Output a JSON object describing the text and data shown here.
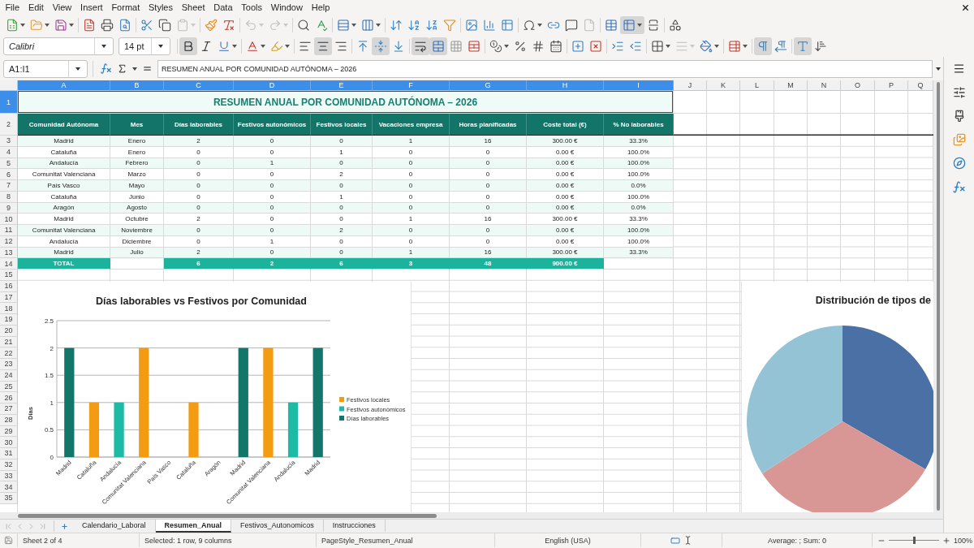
{
  "menu": [
    "File",
    "Edit",
    "View",
    "Insert",
    "Format",
    "Styles",
    "Sheet",
    "Data",
    "Tools",
    "Window",
    "Help"
  ],
  "standard_toolbar": [
    [
      {
        "kind": "new",
        "dropdown": true,
        "pressed": false,
        "disabled": false
      },
      {
        "kind": "open",
        "dropdown": true,
        "pressed": false,
        "disabled": false
      },
      {
        "kind": "save",
        "dropdown": true,
        "pressed": false,
        "disabled": false
      }
    ],
    [
      {
        "kind": "pdf",
        "dropdown": false,
        "pressed": false,
        "disabled": false
      },
      {
        "kind": "print",
        "dropdown": false,
        "pressed": false,
        "disabled": false
      },
      {
        "kind": "preview",
        "dropdown": false,
        "pressed": false,
        "disabled": false
      }
    ],
    [
      {
        "kind": "cut",
        "dropdown": false,
        "pressed": false,
        "disabled": false
      },
      {
        "kind": "copy",
        "dropdown": false,
        "pressed": false,
        "disabled": false
      },
      {
        "kind": "paste",
        "dropdown": true,
        "pressed": false,
        "disabled": true
      }
    ],
    [
      {
        "kind": "clone",
        "dropdown": false,
        "pressed": false,
        "disabled": false
      },
      {
        "kind": "clear",
        "dropdown": false,
        "pressed": false,
        "disabled": false
      }
    ],
    [
      {
        "kind": "undo",
        "dropdown": true,
        "pressed": false,
        "disabled": true
      },
      {
        "kind": "redo",
        "dropdown": true,
        "pressed": false,
        "disabled": true
      }
    ],
    [
      {
        "kind": "find",
        "dropdown": false,
        "pressed": false,
        "disabled": false
      },
      {
        "kind": "spelling",
        "dropdown": false,
        "pressed": false,
        "disabled": false
      }
    ],
    [
      {
        "kind": "rows",
        "dropdown": true,
        "pressed": false,
        "disabled": false
      },
      {
        "kind": "columns",
        "dropdown": true,
        "pressed": false,
        "disabled": false
      }
    ],
    [
      {
        "kind": "sort",
        "dropdown": false,
        "pressed": false,
        "disabled": false
      },
      {
        "kind": "ascending",
        "dropdown": false,
        "pressed": false,
        "disabled": false
      },
      {
        "kind": "descending",
        "dropdown": false,
        "pressed": false,
        "disabled": false
      },
      {
        "kind": "filter",
        "dropdown": false,
        "pressed": false,
        "disabled": false
      }
    ],
    [
      {
        "kind": "image",
        "dropdown": false,
        "pressed": false,
        "disabled": false
      },
      {
        "kind": "chart",
        "dropdown": false,
        "pressed": false,
        "disabled": false
      },
      {
        "kind": "pivot",
        "dropdown": false,
        "pressed": false,
        "disabled": false
      }
    ],
    [
      {
        "kind": "special",
        "dropdown": true,
        "pressed": false,
        "disabled": false
      },
      {
        "kind": "hyperlink",
        "dropdown": false,
        "pressed": false,
        "disabled": false
      },
      {
        "kind": "comment",
        "dropdown": false,
        "pressed": false,
        "disabled": false
      },
      {
        "kind": "headerfooter",
        "dropdown": false,
        "pressed": false,
        "disabled": true
      }
    ],
    [
      {
        "kind": "printarea",
        "dropdown": false,
        "pressed": false,
        "disabled": false
      },
      {
        "kind": "freeze",
        "dropdown": true,
        "pressed": true,
        "disabled": false
      },
      {
        "kind": "split",
        "dropdown": false,
        "pressed": false,
        "disabled": false
      }
    ],
    [
      {
        "kind": "shapes",
        "dropdown": false,
        "pressed": false,
        "disabled": false
      }
    ]
  ],
  "formatting_toolbar": {
    "font_name": "Calibri",
    "font_size": "14 pt",
    "groups": [
      [
        {
          "kind": "bold",
          "dropdown": false,
          "pressed": true,
          "disabled": false
        },
        {
          "kind": "italic",
          "dropdown": false,
          "pressed": false,
          "disabled": false
        },
        {
          "kind": "underline",
          "dropdown": true,
          "pressed": false,
          "disabled": false
        }
      ],
      [
        {
          "kind": "fontcolor",
          "dropdown": true,
          "pressed": false,
          "disabled": false
        },
        {
          "kind": "highlight",
          "dropdown": true,
          "pressed": false,
          "disabled": false
        }
      ],
      [
        {
          "kind": "left",
          "dropdown": false,
          "pressed": false,
          "disabled": false
        },
        {
          "kind": "center",
          "dropdown": false,
          "pressed": true,
          "disabled": false
        },
        {
          "kind": "right",
          "dropdown": false,
          "pressed": false,
          "disabled": false
        }
      ],
      [
        {
          "kind": "top",
          "dropdown": false,
          "pressed": false,
          "disabled": false
        },
        {
          "kind": "middle",
          "dropdown": false,
          "pressed": true,
          "disabled": false
        },
        {
          "kind": "bottom",
          "dropdown": false,
          "pressed": false,
          "disabled": false
        }
      ],
      [
        {
          "kind": "wrap",
          "dropdown": false,
          "pressed": true,
          "disabled": false
        },
        {
          "kind": "mergecenter",
          "dropdown": false,
          "pressed": true,
          "disabled": false
        },
        {
          "kind": "merge",
          "dropdown": false,
          "pressed": false,
          "disabled": false
        },
        {
          "kind": "unmerge",
          "dropdown": false,
          "pressed": false,
          "disabled": false
        }
      ],
      [
        {
          "kind": "currency",
          "dropdown": true,
          "pressed": false,
          "disabled": false
        },
        {
          "kind": "percent",
          "dropdown": false,
          "pressed": false,
          "disabled": false
        },
        {
          "kind": "number",
          "dropdown": false,
          "pressed": false,
          "disabled": false
        },
        {
          "kind": "date",
          "dropdown": false,
          "pressed": false,
          "disabled": false
        }
      ],
      [
        {
          "kind": "adddecimal",
          "dropdown": false,
          "pressed": false,
          "disabled": false
        },
        {
          "kind": "deldecimal",
          "dropdown": false,
          "pressed": false,
          "disabled": false
        }
      ],
      [
        {
          "kind": "indent",
          "dropdown": false,
          "pressed": false,
          "disabled": false
        },
        {
          "kind": "outdent",
          "dropdown": false,
          "pressed": false,
          "disabled": false
        }
      ],
      [
        {
          "kind": "borders",
          "dropdown": true,
          "pressed": false,
          "disabled": false
        },
        {
          "kind": "borderstyle",
          "dropdown": true,
          "pressed": false,
          "disabled": true
        },
        {
          "kind": "bordercolor",
          "dropdown": true,
          "pressed": false,
          "disabled": false
        }
      ],
      [
        {
          "kind": "conditional",
          "dropdown": true,
          "pressed": false,
          "disabled": false
        }
      ],
      [
        {
          "kind": "ltr",
          "dropdown": false,
          "pressed": true,
          "disabled": false
        },
        {
          "kind": "rtl",
          "dropdown": false,
          "pressed": false,
          "disabled": false
        }
      ],
      [
        {
          "kind": "direction",
          "dropdown": false,
          "pressed": true,
          "disabled": false
        },
        {
          "kind": "vertical",
          "dropdown": false,
          "pressed": false,
          "disabled": false
        }
      ]
    ]
  },
  "formula_bar": {
    "name_box": "A1:I1",
    "content": "RESUMEN ANUAL POR COMUNIDAD AUTÓNOMA – 2026"
  },
  "sheet": {
    "columns": [
      {
        "label": "A",
        "selected": true
      },
      {
        "label": "B",
        "selected": true
      },
      {
        "label": "C",
        "selected": true
      },
      {
        "label": "D",
        "selected": true
      },
      {
        "label": "E",
        "selected": true
      },
      {
        "label": "F",
        "selected": true
      },
      {
        "label": "G",
        "selected": true
      },
      {
        "label": "H",
        "selected": true
      },
      {
        "label": "I",
        "selected": true
      },
      {
        "label": "J",
        "selected": false
      },
      {
        "label": "K",
        "selected": false
      },
      {
        "label": "L",
        "selected": false
      },
      {
        "label": "M",
        "selected": false
      },
      {
        "label": "N",
        "selected": false
      },
      {
        "label": "O",
        "selected": false
      },
      {
        "label": "P",
        "selected": false
      },
      {
        "label": "Q",
        "selected": false
      }
    ],
    "rows": [
      {
        "label": "1",
        "selected": true
      },
      {
        "label": "2",
        "selected": false
      },
      {
        "label": "3",
        "selected": false
      },
      {
        "label": "4",
        "selected": false
      },
      {
        "label": "5",
        "selected": false
      },
      {
        "label": "6",
        "selected": false
      },
      {
        "label": "7",
        "selected": false
      },
      {
        "label": "8",
        "selected": false
      },
      {
        "label": "9",
        "selected": false
      },
      {
        "label": "10",
        "selected": false
      },
      {
        "label": "11",
        "selected": false
      },
      {
        "label": "12",
        "selected": false
      },
      {
        "label": "13",
        "selected": false
      },
      {
        "label": "14",
        "selected": false
      },
      {
        "label": "15",
        "selected": false
      },
      {
        "label": "16",
        "selected": false
      },
      {
        "label": "17",
        "selected": false
      },
      {
        "label": "18",
        "selected": false
      },
      {
        "label": "19",
        "selected": false
      },
      {
        "label": "20",
        "selected": false
      },
      {
        "label": "21",
        "selected": false
      },
      {
        "label": "22",
        "selected": false
      },
      {
        "label": "23",
        "selected": false
      },
      {
        "label": "24",
        "selected": false
      },
      {
        "label": "25",
        "selected": false
      },
      {
        "label": "26",
        "selected": false
      },
      {
        "label": "27",
        "selected": false
      },
      {
        "label": "28",
        "selected": false
      },
      {
        "label": "29",
        "selected": false
      },
      {
        "label": "30",
        "selected": false
      },
      {
        "label": "31",
        "selected": false
      },
      {
        "label": "32",
        "selected": false
      },
      {
        "label": "33",
        "selected": false
      },
      {
        "label": "34",
        "selected": false
      },
      {
        "label": "35",
        "selected": false
      }
    ],
    "title": "RESUMEN ANUAL POR COMUNIDAD AUTÓNOMA – 2026",
    "header": [
      "Comunidad Autónoma",
      "Mes",
      "Días laborables",
      "Festivos autonómicos",
      "Festivos locales",
      "Vacaciones empresa",
      "Horas planificadas",
      "Coste total (€)",
      "% No laborables"
    ],
    "data": [
      [
        "Madrid",
        "Enero",
        "2",
        "0",
        "0",
        "1",
        "16",
        "300.00 €",
        "33.3%"
      ],
      [
        "Cataluña",
        "Enero",
        "0",
        "0",
        "1",
        "0",
        "0",
        "0.00 €",
        "100.0%"
      ],
      [
        "Andalucía",
        "Febrero",
        "0",
        "1",
        "0",
        "0",
        "0",
        "0.00 €",
        "100.0%"
      ],
      [
        "Comunitat Valenciana",
        "Marzo",
        "0",
        "0",
        "2",
        "0",
        "0",
        "0.00 €",
        "100.0%"
      ],
      [
        "País Vasco",
        "Mayo",
        "0",
        "0",
        "0",
        "0",
        "0",
        "0.00 €",
        "0.0%"
      ],
      [
        "Cataluña",
        "Junio",
        "0",
        "0",
        "1",
        "0",
        "0",
        "0.00 €",
        "100.0%"
      ],
      [
        "Aragón",
        "Agosto",
        "0",
        "0",
        "0",
        "0",
        "0",
        "0.00 €",
        "0.0%"
      ],
      [
        "Madrid",
        "Octubre",
        "2",
        "0",
        "0",
        "1",
        "16",
        "300.00 €",
        "33.3%"
      ],
      [
        "Comunitat Valenciana",
        "Noviembre",
        "0",
        "0",
        "2",
        "0",
        "0",
        "0.00 €",
        "100.0%"
      ],
      [
        "Andalucía",
        "Diciembre",
        "0",
        "1",
        "0",
        "0",
        "0",
        "0.00 €",
        "100.0%"
      ],
      [
        "Madrid",
        "Julio",
        "2",
        "0",
        "0",
        "1",
        "16",
        "300.00 €",
        "33.3%"
      ]
    ],
    "total": {
      "label": "TOTAL",
      "values": [
        "6",
        "2",
        "6",
        "3",
        "48",
        "900.00 €"
      ]
    }
  },
  "bar_chart": {
    "chart_data": {
      "type": "bar",
      "title": "Días laborables vs Festivos por Comunidad",
      "ylabel": "Días",
      "categories": [
        "Madrid",
        "Cataluña",
        "Andalucía",
        "Comunitat Valenciana",
        "País Vasco",
        "Cataluña",
        "Aragón",
        "Madrid",
        "Comunitat Valenciana",
        "Andalucía",
        "Madrid"
      ],
      "series": [
        {
          "name": "Días laborables",
          "color": "#13766b",
          "values": [
            2,
            0,
            0,
            0,
            0,
            0,
            0,
            2,
            0,
            0,
            2
          ]
        },
        {
          "name": "Festivos autonómicos",
          "color": "#1dbba5",
          "values": [
            0,
            0,
            1,
            0,
            0,
            0,
            0,
            0,
            0,
            1,
            0
          ]
        },
        {
          "name": "Festivos locales",
          "color": "#f39c12",
          "values": [
            0,
            1,
            0,
            2,
            0,
            1,
            0,
            0,
            2,
            0,
            0
          ]
        }
      ],
      "ylim": [
        0,
        2.5
      ],
      "yticks": [
        0,
        0.5,
        1,
        1.5,
        2,
        2.5
      ],
      "stacked": true,
      "grid": true,
      "legend": "right"
    }
  },
  "pie_chart": {
    "title": "Distribución de tipos de"
  },
  "sheet_tabs": [
    {
      "label": "Calendario_Laboral",
      "selected": false
    },
    {
      "label": "Resumen_Anual",
      "selected": true
    },
    {
      "label": "Festivos_Autonomicos",
      "selected": false
    },
    {
      "label": "Instrucciones",
      "selected": false
    }
  ],
  "status_bar": {
    "sheet": "Sheet 2 of 4",
    "selection": "Selected: 1 row, 9 columns",
    "page_style": "PageStyle_Resumen_Anual",
    "language": "English (USA)",
    "sum": "Average: ; Sum: 0",
    "zoom": {
      "level": 0.5,
      "reading": "100%"
    }
  }
}
